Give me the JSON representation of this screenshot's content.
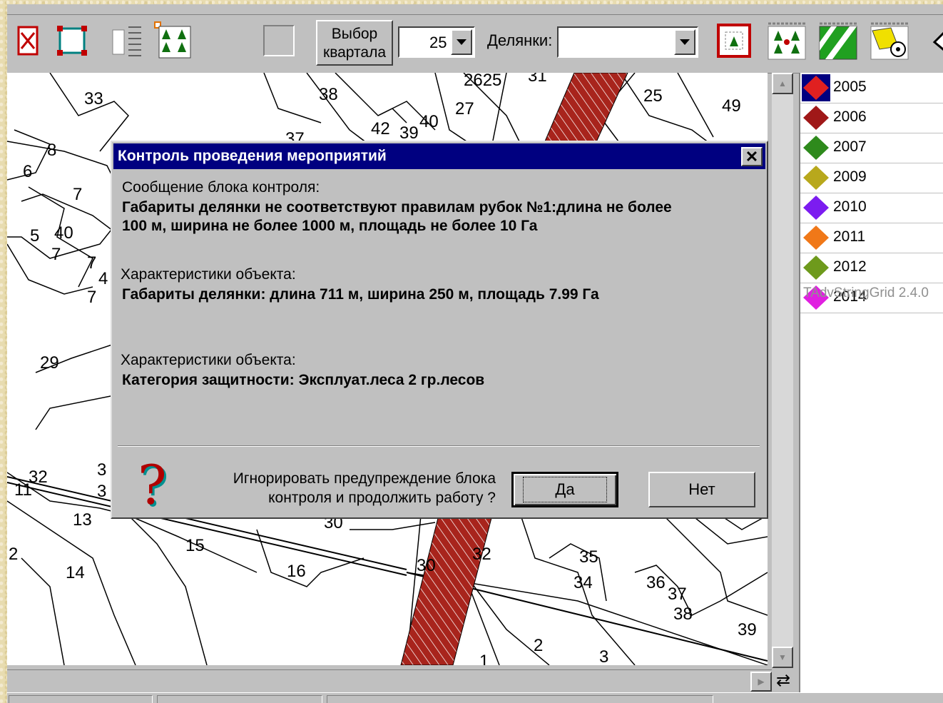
{
  "toolbar": {
    "quarter_button_line1": "Выбор",
    "quarter_button_line2": "квартала",
    "quarter_number": "25",
    "plots_label": "Делянки:",
    "plots_value": ""
  },
  "map": {
    "labels": [
      "33",
      "38",
      "2625",
      "31",
      "25",
      "49",
      "27",
      "40",
      "42",
      "39",
      "37",
      "8",
      "6",
      "7",
      "5",
      "40",
      "7",
      "7",
      "4",
      "7",
      "29",
      "32",
      "3",
      "3",
      "11",
      "13",
      "30",
      "15",
      "14",
      "2",
      "16",
      "30",
      "32",
      "35",
      "34",
      "36",
      "37",
      "38",
      "39",
      "2",
      "1",
      "3"
    ]
  },
  "legend": {
    "items": [
      {
        "label": "2005",
        "color": "#e02020"
      },
      {
        "label": "2006",
        "color": "#a01818"
      },
      {
        "label": "2007",
        "color": "#2e8a1c"
      },
      {
        "label": "2009",
        "color": "#b8a81c"
      },
      {
        "label": "2010",
        "color": "#7c1cf0"
      },
      {
        "label": "2011",
        "color": "#f07818"
      },
      {
        "label": "2012",
        "color": "#6e9a1c"
      },
      {
        "label": "2014",
        "color": "#e020e0"
      }
    ],
    "watermark": "TAdvStringGrid 2.4.0"
  },
  "dialog": {
    "title": "Контроль проведения мероприятий",
    "msg_label": "Сообщение блока контроля:",
    "msg_line1": "Габариты делянки не соответствуют правилам рубок №1:длина не более",
    "msg_line2": "100 м, ширина не более 1000 м, площадь не более 10 Га",
    "char1_label": "Характеристики объекта:",
    "char1_value": "Габариты делянки: длина 711 м, ширина 250 м, площадь 7.99 Га",
    "char2_label": "Характеристики объекта:",
    "char2_value": "Категория защитности: Эксплуат.леса 2 гр.лесов",
    "prompt_line1": "Игнорировать предупреждение блока",
    "prompt_line2": "контроля и продолжить работу ?",
    "yes_label": "Да",
    "no_label": "Нет",
    "close_glyph": "✕",
    "question_glyph": "?"
  }
}
